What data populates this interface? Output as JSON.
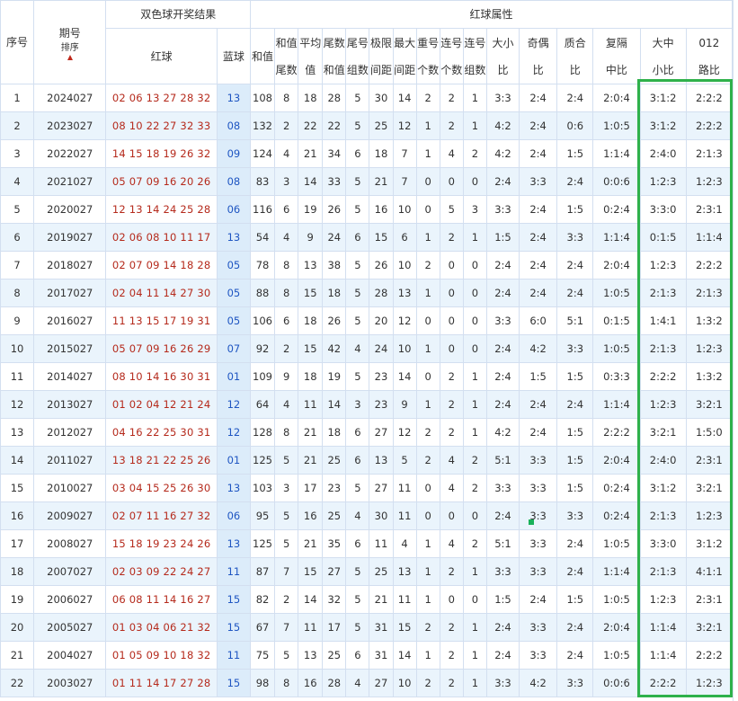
{
  "header": {
    "seq": "序号",
    "issue": "期号",
    "sort": "排序",
    "result_group": "双色球开奖结果",
    "red": "红球",
    "blue": "蓝球",
    "attr_group": "红球属性",
    "cols": [
      "和值",
      "和值尾数",
      "平均值",
      "尾数和值",
      "尾号组数",
      "极限间距",
      "最大间距",
      "重号个数",
      "连号个数",
      "连号组数",
      "大小比",
      "奇偶比",
      "质合比",
      "复隔中比",
      "大中小比",
      "012路比"
    ]
  },
  "rows": [
    [
      "1",
      "2024027",
      "02 06 13 27 28 32",
      "13",
      "108",
      "8",
      "18",
      "28",
      "5",
      "30",
      "14",
      "2",
      "2",
      "1",
      "3:3",
      "2:4",
      "2:4",
      "2:0:4",
      "3:1:2",
      "2:2:2"
    ],
    [
      "2",
      "2023027",
      "08 10 22 27 32 33",
      "08",
      "132",
      "2",
      "22",
      "22",
      "5",
      "25",
      "12",
      "1",
      "2",
      "1",
      "4:2",
      "2:4",
      "0:6",
      "1:0:5",
      "3:1:2",
      "2:2:2"
    ],
    [
      "3",
      "2022027",
      "14 15 18 19 26 32",
      "09",
      "124",
      "4",
      "21",
      "34",
      "6",
      "18",
      "7",
      "1",
      "4",
      "2",
      "4:2",
      "2:4",
      "1:5",
      "1:1:4",
      "2:4:0",
      "2:1:3"
    ],
    [
      "4",
      "2021027",
      "05 07 09 16 20 26",
      "08",
      "83",
      "3",
      "14",
      "33",
      "5",
      "21",
      "7",
      "0",
      "0",
      "0",
      "2:4",
      "3:3",
      "2:4",
      "0:0:6",
      "1:2:3",
      "1:2:3"
    ],
    [
      "5",
      "2020027",
      "12 13 14 24 25 28",
      "06",
      "116",
      "6",
      "19",
      "26",
      "5",
      "16",
      "10",
      "0",
      "5",
      "3",
      "3:3",
      "2:4",
      "1:5",
      "0:2:4",
      "3:3:0",
      "2:3:1"
    ],
    [
      "6",
      "2019027",
      "02 06 08 10 11 17",
      "13",
      "54",
      "4",
      "9",
      "24",
      "6",
      "15",
      "6",
      "1",
      "2",
      "1",
      "1:5",
      "2:4",
      "3:3",
      "1:1:4",
      "0:1:5",
      "1:1:4"
    ],
    [
      "7",
      "2018027",
      "02 07 09 14 18 28",
      "05",
      "78",
      "8",
      "13",
      "38",
      "5",
      "26",
      "10",
      "2",
      "0",
      "0",
      "2:4",
      "2:4",
      "2:4",
      "2:0:4",
      "1:2:3",
      "2:2:2"
    ],
    [
      "8",
      "2017027",
      "02 04 11 14 27 30",
      "05",
      "88",
      "8",
      "15",
      "18",
      "5",
      "28",
      "13",
      "1",
      "0",
      "0",
      "2:4",
      "2:4",
      "2:4",
      "1:0:5",
      "2:1:3",
      "2:1:3"
    ],
    [
      "9",
      "2016027",
      "11 13 15 17 19 31",
      "05",
      "106",
      "6",
      "18",
      "26",
      "5",
      "20",
      "12",
      "0",
      "0",
      "0",
      "3:3",
      "6:0",
      "5:1",
      "0:1:5",
      "1:4:1",
      "1:3:2"
    ],
    [
      "10",
      "2015027",
      "05 07 09 16 26 29",
      "07",
      "92",
      "2",
      "15",
      "42",
      "4",
      "24",
      "10",
      "1",
      "0",
      "0",
      "2:4",
      "4:2",
      "3:3",
      "1:0:5",
      "2:1:3",
      "1:2:3"
    ],
    [
      "11",
      "2014027",
      "08 10 14 16 30 31",
      "01",
      "109",
      "9",
      "18",
      "19",
      "5",
      "23",
      "14",
      "0",
      "2",
      "1",
      "2:4",
      "1:5",
      "1:5",
      "0:3:3",
      "2:2:2",
      "1:3:2"
    ],
    [
      "12",
      "2013027",
      "01 02 04 12 21 24",
      "12",
      "64",
      "4",
      "11",
      "14",
      "3",
      "23",
      "9",
      "1",
      "2",
      "1",
      "2:4",
      "2:4",
      "2:4",
      "1:1:4",
      "1:2:3",
      "3:2:1"
    ],
    [
      "13",
      "2012027",
      "04 16 22 25 30 31",
      "12",
      "128",
      "8",
      "21",
      "18",
      "6",
      "27",
      "12",
      "2",
      "2",
      "1",
      "4:2",
      "2:4",
      "1:5",
      "2:2:2",
      "3:2:1",
      "1:5:0"
    ],
    [
      "14",
      "2011027",
      "13 18 21 22 25 26",
      "01",
      "125",
      "5",
      "21",
      "25",
      "6",
      "13",
      "5",
      "2",
      "4",
      "2",
      "5:1",
      "3:3",
      "1:5",
      "2:0:4",
      "2:4:0",
      "2:3:1"
    ],
    [
      "15",
      "2010027",
      "03 04 15 25 26 30",
      "13",
      "103",
      "3",
      "17",
      "23",
      "5",
      "27",
      "11",
      "0",
      "4",
      "2",
      "3:3",
      "3:3",
      "1:5",
      "0:2:4",
      "3:1:2",
      "3:2:1"
    ],
    [
      "16",
      "2009027",
      "02 07 11 16 27 32",
      "06",
      "95",
      "5",
      "16",
      "25",
      "4",
      "30",
      "11",
      "0",
      "0",
      "0",
      "2:4",
      "3:3",
      "3:3",
      "0:2:4",
      "2:1:3",
      "1:2:3"
    ],
    [
      "17",
      "2008027",
      "15 18 19 23 24 26",
      "13",
      "125",
      "5",
      "21",
      "35",
      "6",
      "11",
      "4",
      "1",
      "4",
      "2",
      "5:1",
      "3:3",
      "2:4",
      "1:0:5",
      "3:3:0",
      "3:1:2"
    ],
    [
      "18",
      "2007027",
      "02 03 09 22 24 27",
      "11",
      "87",
      "7",
      "15",
      "27",
      "5",
      "25",
      "13",
      "1",
      "2",
      "1",
      "3:3",
      "3:3",
      "2:4",
      "1:1:4",
      "2:1:3",
      "4:1:1"
    ],
    [
      "19",
      "2006027",
      "06 08 11 14 16 27",
      "15",
      "82",
      "2",
      "14",
      "32",
      "5",
      "21",
      "11",
      "1",
      "0",
      "0",
      "1:5",
      "2:4",
      "1:5",
      "1:0:5",
      "1:2:3",
      "2:3:1"
    ],
    [
      "20",
      "2005027",
      "01 03 04 06 21 32",
      "15",
      "67",
      "7",
      "11",
      "17",
      "5",
      "31",
      "15",
      "2",
      "2",
      "1",
      "2:4",
      "3:3",
      "2:4",
      "2:0:4",
      "1:1:4",
      "3:2:1"
    ],
    [
      "21",
      "2004027",
      "01 05 09 10 18 32",
      "11",
      "75",
      "5",
      "13",
      "25",
      "6",
      "31",
      "14",
      "1",
      "2",
      "1",
      "2:4",
      "3:3",
      "2:4",
      "1:0:5",
      "1:1:4",
      "2:2:2"
    ],
    [
      "22",
      "2003027",
      "01 11 14 17 27 28",
      "15",
      "98",
      "8",
      "16",
      "28",
      "4",
      "27",
      "10",
      "2",
      "2",
      "1",
      "3:3",
      "4:2",
      "3:3",
      "0:0:6",
      "2:2:2",
      "1:2:3"
    ]
  ],
  "colors": {
    "red_ball": "#b52a1c",
    "blue_ball": "#1f56c2",
    "highlight": "#2fb14b",
    "row_alt": "#eaf4fc"
  }
}
